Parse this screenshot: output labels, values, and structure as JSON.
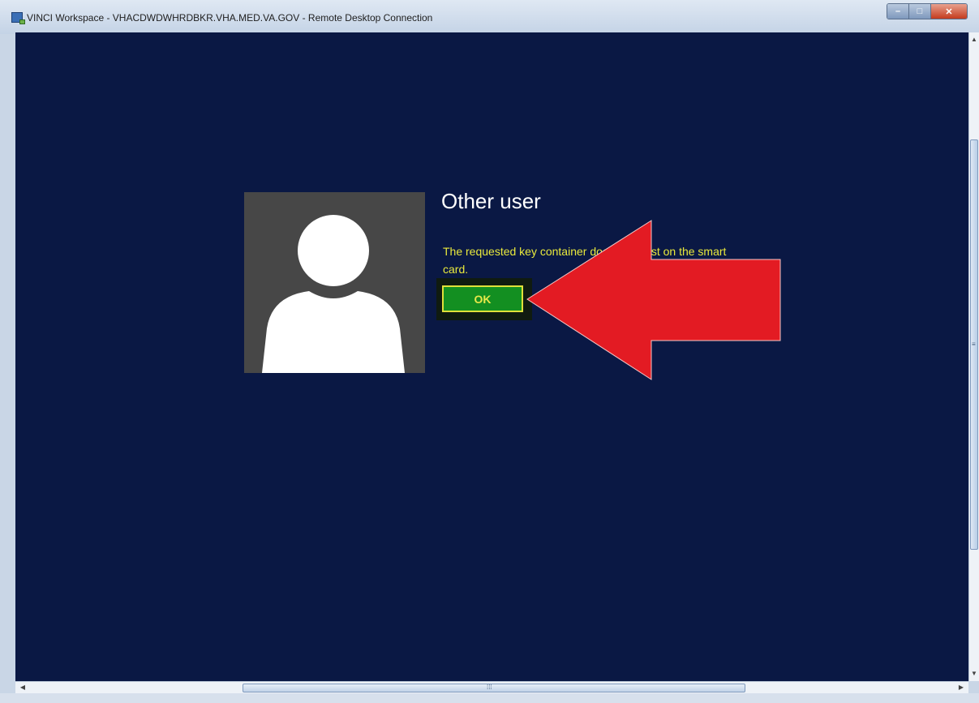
{
  "window": {
    "title": "VINCI Workspace - VHACDWDWHRDBKR.VHA.MED.VA.GOV - Remote Desktop Connection",
    "minimize_glyph": "–",
    "maximize_glyph": "□",
    "close_glyph": "✕"
  },
  "login": {
    "user_name": "Other user",
    "message": "The requested key container does not exist on the smart card.",
    "ok_label": "OK"
  },
  "scrollbars": {
    "up_glyph": "▲",
    "down_glyph": "▼",
    "left_glyph": "◀",
    "right_glyph": "▶",
    "v_grip": "≡",
    "h_grip": "⁞⁞⁞"
  },
  "icons": {
    "app": "remote-desktop-icon",
    "avatar": "user-silhouette-icon",
    "annotation": "red-arrow-icon"
  },
  "colors": {
    "desktop_bg": "#0a1844",
    "message_text": "#e9e93c",
    "ok_bg": "#138f21",
    "ok_border": "#e0e03a",
    "arrow": "#e31b23"
  }
}
